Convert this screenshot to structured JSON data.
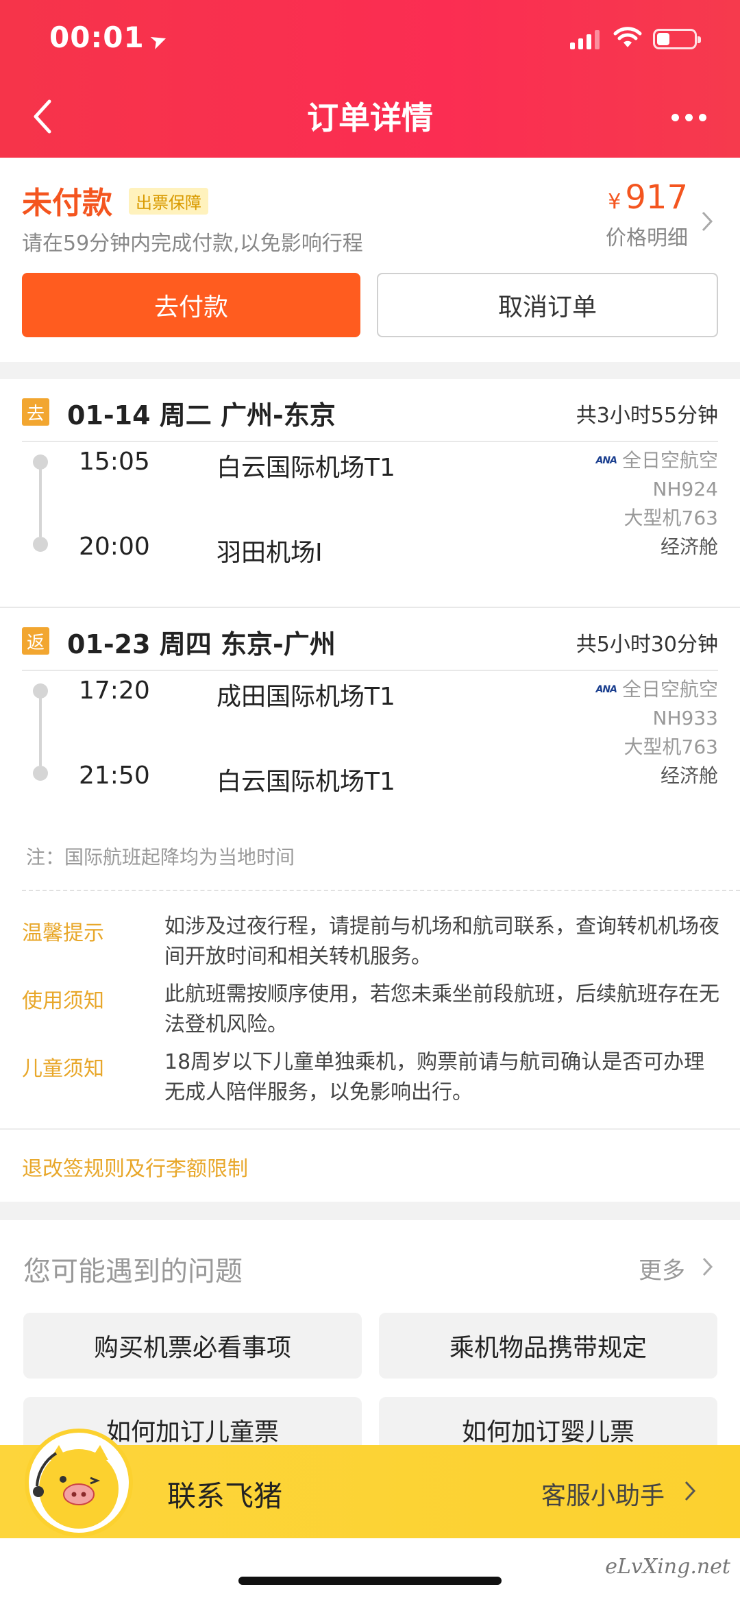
{
  "status_bar": {
    "time": "00:01",
    "location_icon": "navigation-arrow-icon"
  },
  "nav": {
    "title": "订单详情",
    "back_icon": "chevron-left-icon",
    "more_icon": "more-dots-icon"
  },
  "order": {
    "status": "未付款",
    "badge": "出票保障",
    "hint": "请在59分钟内完成付款,以免影响行程",
    "currency": "¥",
    "price": "917",
    "price_detail": "价格明细",
    "pay_label": "去付款",
    "cancel_label": "取消订单"
  },
  "segments": [
    {
      "tag": "去",
      "date_route": "01-14 周二 广州-东京",
      "duration": "共3小时55分钟",
      "dep_time": "15:05",
      "dep_airport": "白云国际机场T1",
      "arr_time": "20:00",
      "arr_airport": "羽田机场I",
      "airline_logo": "ANA",
      "airline": "全日空航空",
      "flight_no": "NH924",
      "aircraft": "大型机763",
      "cabin": "经济舱"
    },
    {
      "tag": "返",
      "date_route": "01-23 周四 东京-广州",
      "duration": "共5小时30分钟",
      "dep_time": "17:20",
      "dep_airport": "成田国际机场T1",
      "arr_time": "21:50",
      "arr_airport": "白云国际机场T1",
      "airline_logo": "ANA",
      "airline": "全日空航空",
      "flight_no": "NH933",
      "aircraft": "大型机763",
      "cabin": "经济舱"
    }
  ],
  "note": "注：国际航班起降均为当地时间",
  "tips": [
    {
      "label": "温馨提示",
      "text": "如涉及过夜行程，请提前与机场和航司联系，查询转机机场夜间开放时间和相关转机服务。"
    },
    {
      "label": "使用须知",
      "text": "此航班需按顺序使用，若您未乘坐前段航班，后续航班存在无法登机风险。"
    },
    {
      "label": "儿童须知",
      "text": "18周岁以下儿童单独乘机，购票前请与航司确认是否可办理无成人陪伴服务，以免影响出行。"
    }
  ],
  "rules_link": "退改签规则及行李额限制",
  "faq": {
    "title": "您可能遇到的问题",
    "more": "更多",
    "items": [
      "购买机票必看事项",
      "乘机物品携带规定",
      "如何加订儿童票",
      "如何加订婴儿票"
    ]
  },
  "contact": {
    "label": "联系飞猪",
    "assistant": "客服小助手"
  },
  "watermark": "eLvXing.net",
  "colors": {
    "header_red": "#f6344a",
    "accent_orange": "#f4551f",
    "pay_button": "#ff5c1f",
    "tip_gold": "#e8a72a",
    "contact_yellow": "#fcd12f"
  }
}
